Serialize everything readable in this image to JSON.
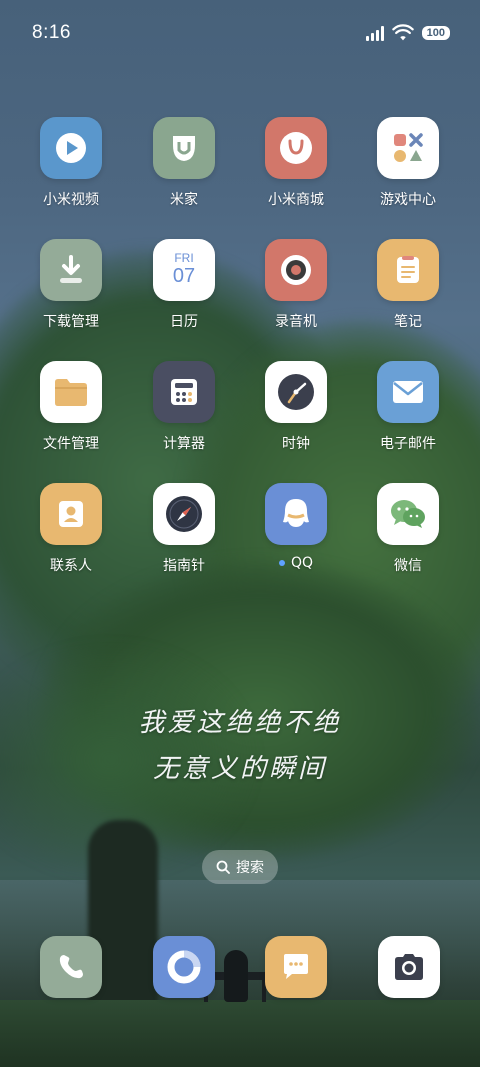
{
  "status_bar": {
    "time": "8:16",
    "battery": "100"
  },
  "apps": [
    {
      "label": "小米视频",
      "icon": "play-icon",
      "bg": "#5a97cc"
    },
    {
      "label": "米家",
      "icon": "mijia-icon",
      "bg": "#8aa68f"
    },
    {
      "label": "小米商城",
      "icon": "shopping-bag-icon",
      "bg": "#d2776a"
    },
    {
      "label": "游戏中心",
      "icon": "game-shapes-icon",
      "bg": "#ffffff"
    },
    {
      "label": "下载管理",
      "icon": "download-icon",
      "bg": "#94ab98"
    },
    {
      "label": "日历",
      "icon": "calendar-icon",
      "bg": "#ffffff",
      "weekday": "FRI",
      "day": "07"
    },
    {
      "label": "录音机",
      "icon": "record-icon",
      "bg": "#d2776a"
    },
    {
      "label": "笔记",
      "icon": "notes-icon",
      "bg": "#e8b870"
    },
    {
      "label": "文件管理",
      "icon": "folder-icon",
      "bg": "#ffffff"
    },
    {
      "label": "计算器",
      "icon": "calculator-icon",
      "bg": "#4a4e62"
    },
    {
      "label": "时钟",
      "icon": "clock-icon",
      "bg": "#ffffff"
    },
    {
      "label": "电子邮件",
      "icon": "mail-icon",
      "bg": "#6aa0d6"
    },
    {
      "label": "联系人",
      "icon": "contact-icon",
      "bg": "#e8b870"
    },
    {
      "label": "指南针",
      "icon": "compass-icon",
      "bg": "#ffffff"
    },
    {
      "label": "QQ",
      "icon": "qq-penguin-icon",
      "bg": "#6a8fd6"
    },
    {
      "label": "微信",
      "icon": "wechat-icon",
      "bg": "#ffffff"
    }
  ],
  "wallpaper_text": {
    "line1": "我爱这绝绝不绝",
    "line2": "无意义的瞬间"
  },
  "search": {
    "label": "搜索"
  },
  "dock": [
    {
      "icon": "phone-icon",
      "bg": "#94ab98"
    },
    {
      "icon": "browser-ring-icon",
      "bg": "#6a8fd6"
    },
    {
      "icon": "message-icon",
      "bg": "#e8b870"
    },
    {
      "icon": "camera-icon",
      "bg": "#ffffff"
    }
  ]
}
